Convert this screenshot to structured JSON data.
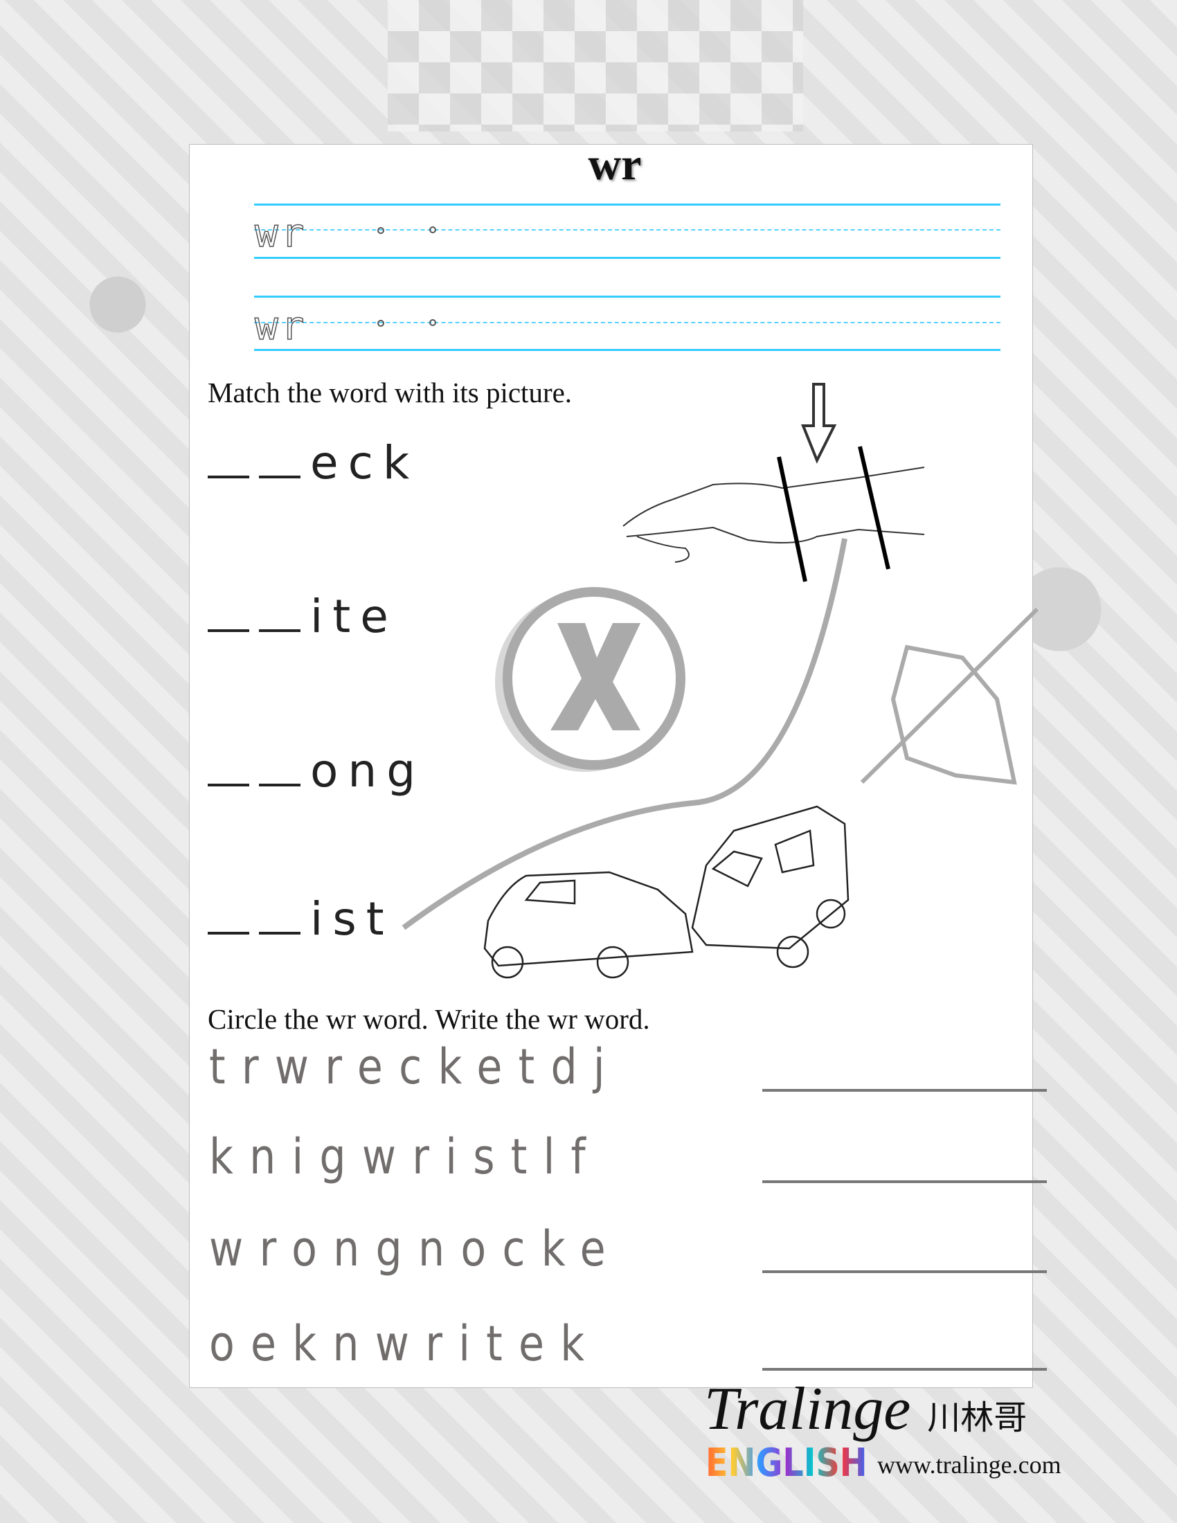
{
  "title": "wr",
  "tracing": {
    "rows": [
      "wr",
      "wr"
    ]
  },
  "match": {
    "instruction": "Match the word with its picture.",
    "items": [
      "eck",
      "ite",
      "ong",
      "ist"
    ],
    "pictures": [
      "wrist-icon",
      "wrong-x-icon",
      "writing-hand-icon",
      "car-wreck-icon"
    ]
  },
  "circle": {
    "instruction": "Circle the wr word. Write the wr word.",
    "rows": [
      "trwrecketdj",
      "knigwristlf",
      "wrongnocke",
      "oeknwritek"
    ]
  },
  "logo": {
    "brand": "Tralinge",
    "chinese": "川林哥",
    "english": "ENGLISH",
    "url": "www.tralinge.com"
  },
  "colors": {
    "guide_line": "#33ccff",
    "letters": "#716d6d"
  }
}
